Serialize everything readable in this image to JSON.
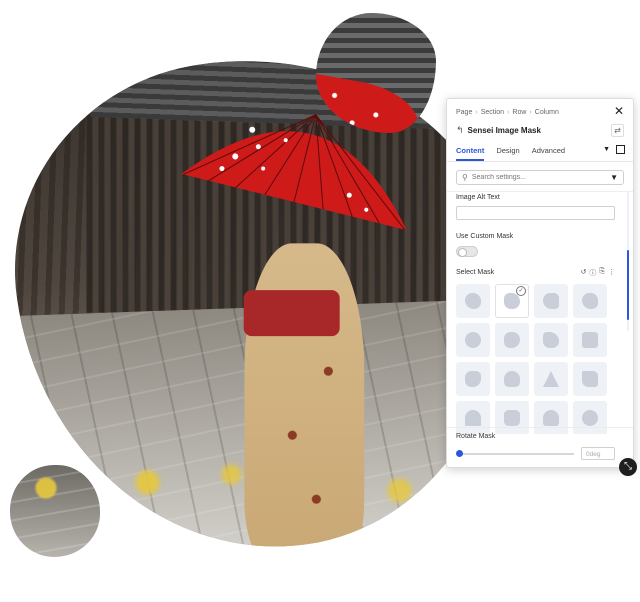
{
  "breadcrumb": [
    "Page",
    "Section",
    "Row",
    "Column"
  ],
  "panel": {
    "title": "Sensei Image Mask",
    "tabs": [
      {
        "label": "Content",
        "active": true
      },
      {
        "label": "Design",
        "active": false
      },
      {
        "label": "Advanced",
        "active": false
      }
    ],
    "search_placeholder": "Search settings...",
    "image_alt_label": "Image Alt Text",
    "image_alt_value": "",
    "custom_mask_label": "Use Custom Mask",
    "custom_mask_on": false,
    "select_mask_label": "Select Mask",
    "selected_mask_index": 1,
    "rotate_label": "Rotate Mask",
    "rotate_value": 0,
    "rotate_placeholder": "0deg"
  },
  "colors": {
    "accent": "#2d57d8",
    "umbrella_red": "#cf1a1a",
    "mask_tile": "#eef1f6"
  },
  "icons": {
    "close": "close-icon",
    "back": "back-arrow-icon",
    "settings": "settings-icon",
    "search": "search-icon",
    "filter": "filter-icon",
    "reset": "reset-icon",
    "help": "help-icon",
    "copy": "copy-icon",
    "more": "more-icon",
    "resize": "resize-icon"
  }
}
